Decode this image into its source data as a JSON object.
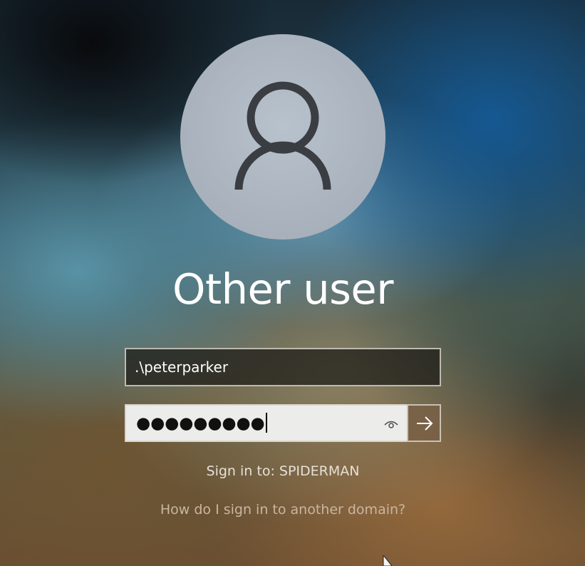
{
  "user": {
    "display_name": "Other user",
    "avatar_icon": "user-silhouette-icon"
  },
  "username_field": {
    "value": ".\\peterparker"
  },
  "password_field": {
    "masked_value": "●●●●●●●●●",
    "reveal_icon": "eye-icon"
  },
  "submit": {
    "icon": "arrow-right-icon"
  },
  "sign_in_target": "Sign in to: SPIDERMAN",
  "other_domain_link": "How do I sign in to another domain?",
  "colors": {
    "avatar_bg": "#a9b3bd",
    "avatar_glyph": "#3a3d42",
    "text_primary": "#ffffff",
    "link_text": "#c9b6a2"
  }
}
